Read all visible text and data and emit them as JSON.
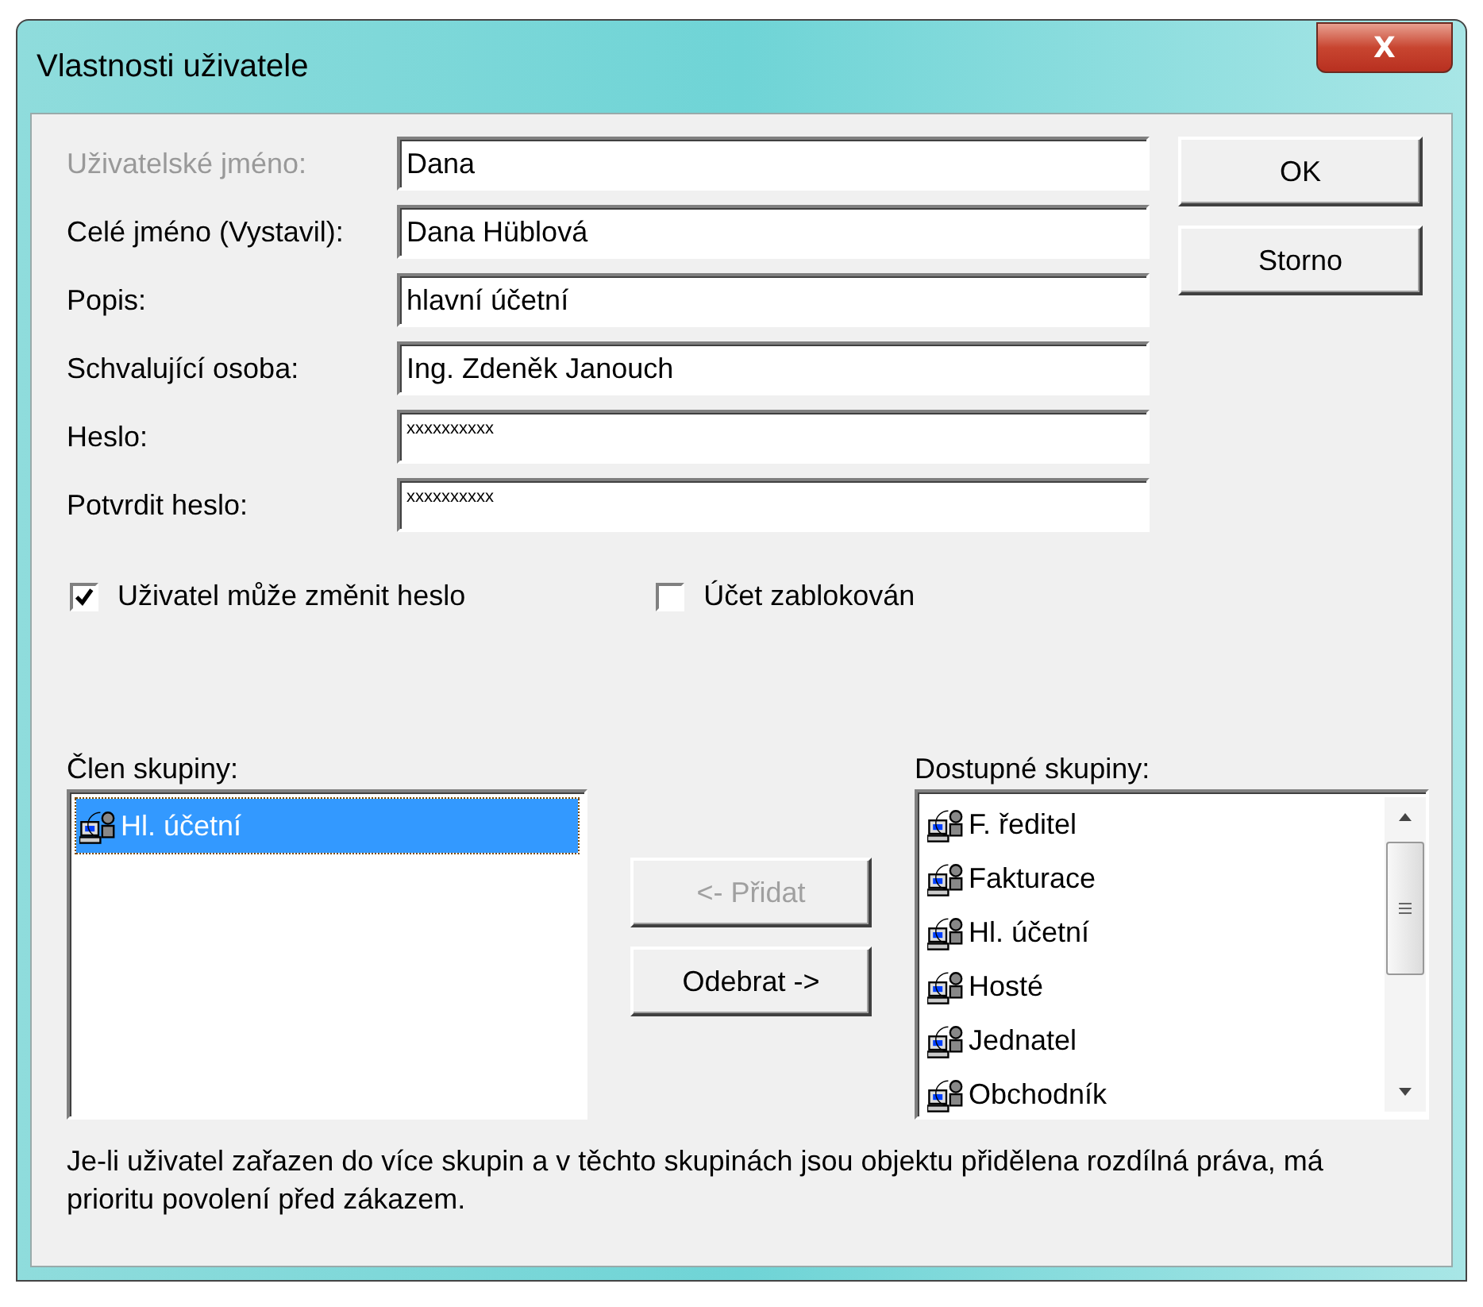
{
  "window": {
    "title": "Vlastnosti uživatele",
    "close": "X"
  },
  "fields": [
    {
      "label": "Uživatelské jméno:",
      "value": "Dana",
      "disabled": true
    },
    {
      "label": "Celé jméno (Vystavil):",
      "value": "Dana Hüblová",
      "disabled": false
    },
    {
      "label": "Popis:",
      "value": "hlavní účetní",
      "disabled": false
    },
    {
      "label": "Schvalující osoba:",
      "value": "Ing. Zdeněk Janouch",
      "disabled": false
    },
    {
      "label": "Heslo:",
      "value": "xxxxxxxxxx",
      "disabled": false,
      "kind": "password"
    },
    {
      "label": "Potvrdit heslo:",
      "value": "xxxxxxxxxx",
      "disabled": false,
      "kind": "password"
    }
  ],
  "buttons": [
    {
      "label": "OK"
    },
    {
      "label": "Storno"
    }
  ],
  "checkboxes": [
    {
      "label": "Uživatel může změnit heslo",
      "checked": true
    },
    {
      "label": "Účet zablokován",
      "checked": false
    }
  ],
  "member_list": {
    "label": "Člen skupiny:",
    "items": [
      {
        "label": "Hl. účetní",
        "selected": true
      }
    ]
  },
  "move_buttons": [
    {
      "label": "<- Přidat",
      "disabled": true
    },
    {
      "label": "Odebrat ->",
      "disabled": false
    }
  ],
  "available_list": {
    "label": "Dostupné skupiny:",
    "items": [
      {
        "label": "F. ředitel",
        "selected": false
      },
      {
        "label": "Fakturace",
        "selected": false
      },
      {
        "label": "Hl. účetní",
        "selected": false
      },
      {
        "label": "Hosté",
        "selected": false
      },
      {
        "label": "Jednatel",
        "selected": false
      },
      {
        "label": "Obchodník",
        "selected": false
      }
    ]
  },
  "note": "Je-li uživatel zařazen do více skupin a v těchto skupinách jsou objektu přidělena rozdílná práva, má prioritu povolení před zákazem."
}
